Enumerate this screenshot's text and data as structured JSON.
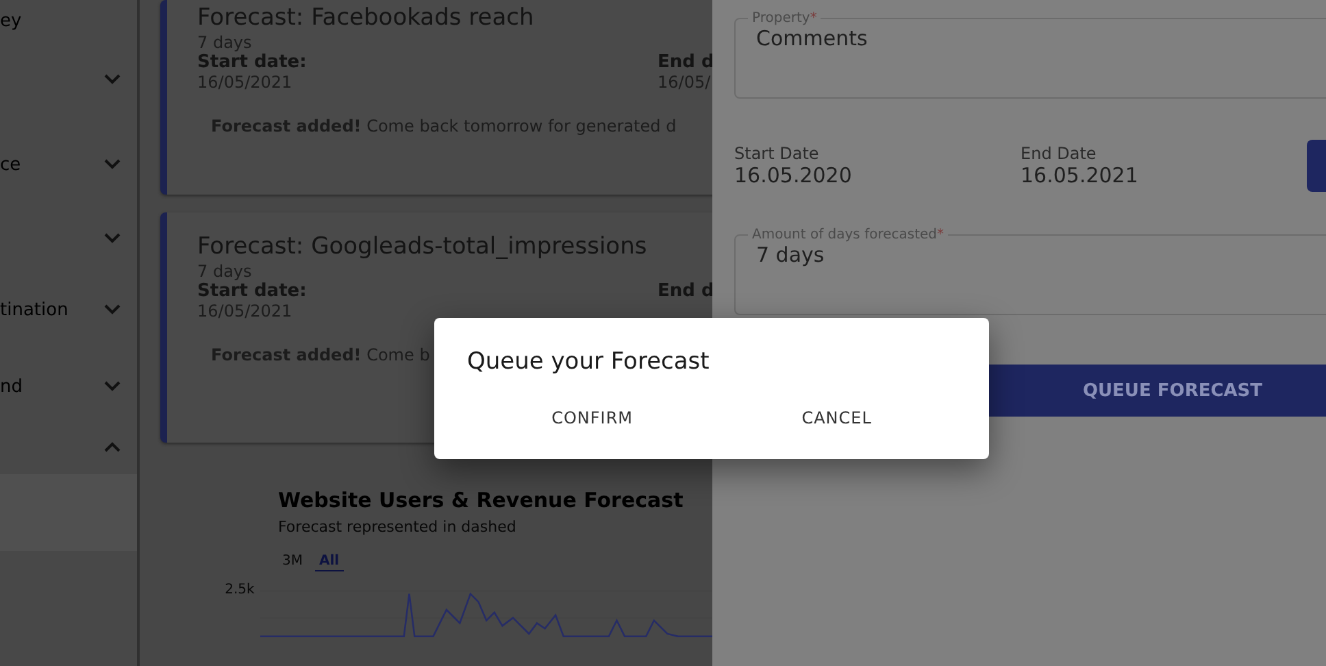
{
  "sidebar": {
    "items": [
      {
        "label": "ey"
      },
      {
        "expanded": false
      },
      {
        "label": "ce",
        "expanded": false
      },
      {
        "expanded": false
      },
      {
        "label": "tination",
        "expanded": false
      },
      {
        "label": "nd",
        "expanded": false
      },
      {
        "expanded": true
      }
    ]
  },
  "forecasts": [
    {
      "title": "Forecast: Facebookads reach",
      "days": "7 days",
      "start_label": "Start date:",
      "start_value": "16/05/2021",
      "end_label": "End d",
      "end_value": "16/05/",
      "note": "**Forecast added!** Come back tomorrow for generated d"
    },
    {
      "title": "Forecast: Googleads-total_impressions",
      "days": "7 days",
      "start_label": "Start date:",
      "start_value": "16/05/2021",
      "end_label": "End d",
      "note": "**Forecast added!** Come b"
    }
  ],
  "chart": {
    "title": "Website Users & Revenue Forecast",
    "subtitle": "Forecast represented in dashed",
    "tabs": [
      {
        "label": "3M",
        "selected": false
      },
      {
        "label": "All",
        "selected": true
      }
    ],
    "ytick": "2.5k"
  },
  "panel": {
    "property": {
      "label": "Property",
      "required_mark": "*",
      "value": "Comments"
    },
    "start": {
      "label": "Start Date",
      "value": "16.05.2020"
    },
    "end": {
      "label": "End Date",
      "value": "16.05.2021"
    },
    "days": {
      "label": "Amount of days forecasted",
      "required_mark": "*",
      "value": "7 days"
    },
    "submit": "QUEUE FORECAST"
  },
  "dialog": {
    "title": "Queue your Forecast",
    "buttons": [
      "CONFIRM",
      "CANCEL"
    ]
  }
}
